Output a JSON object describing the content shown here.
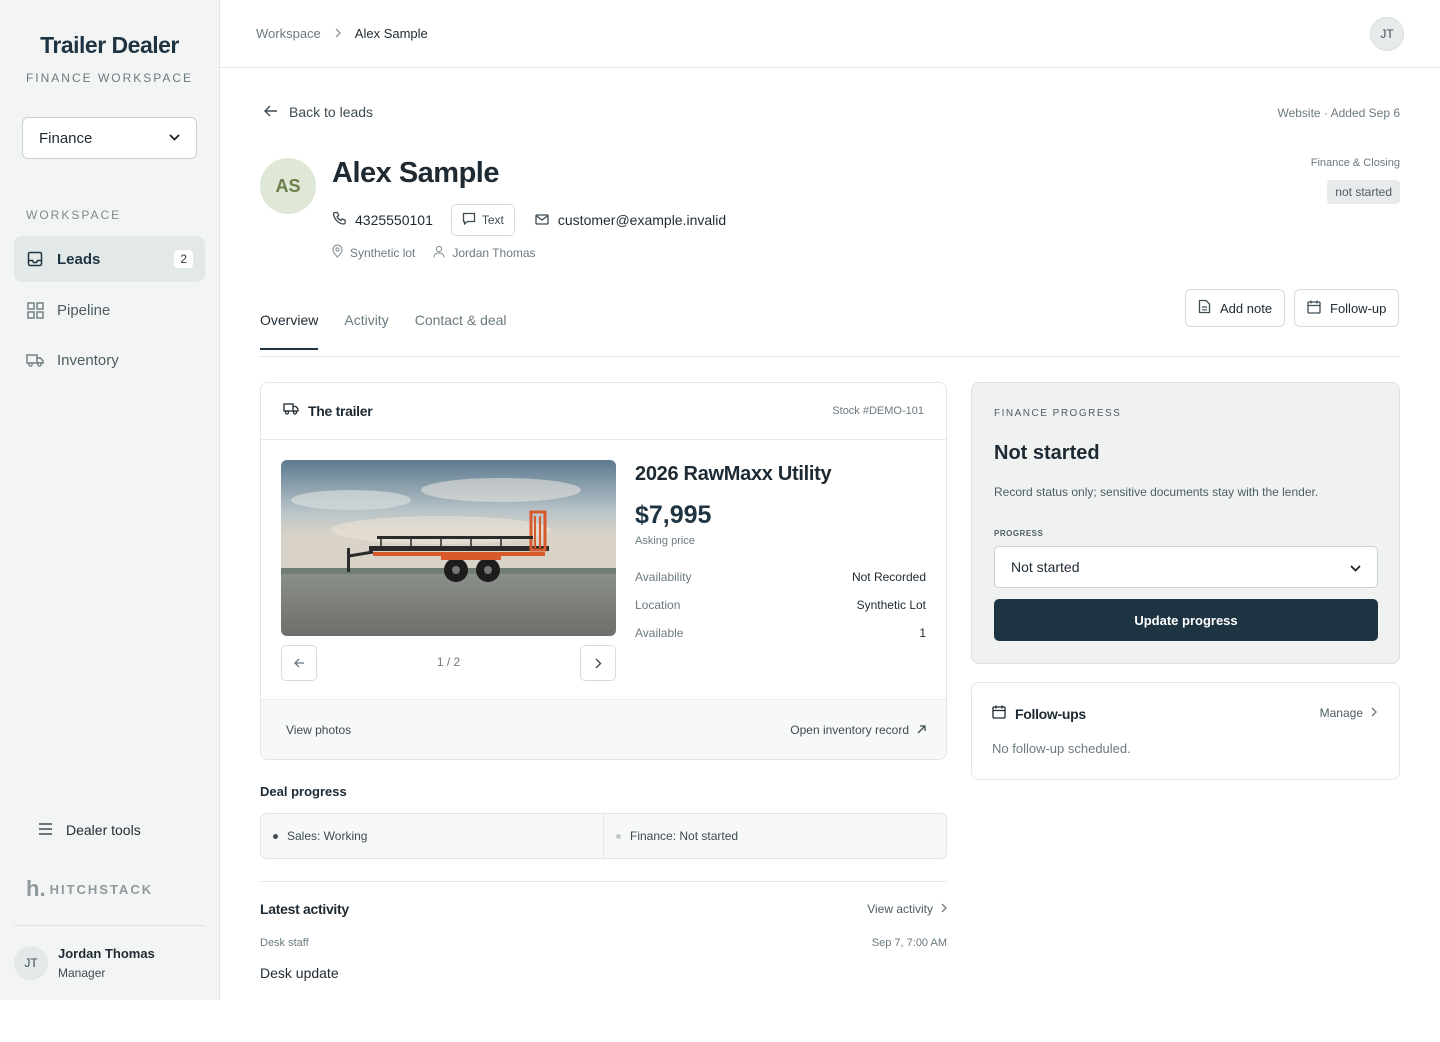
{
  "sidebar": {
    "brand": "Trailer Dealer",
    "brand_sub": "FINANCE WORKSPACE",
    "workspace_select": "Finance",
    "section_label": "WORKSPACE",
    "nav": [
      {
        "label": "Leads",
        "icon": "inbox-icon",
        "badge": "2",
        "active": true
      },
      {
        "label": "Pipeline",
        "icon": "grid-icon"
      },
      {
        "label": "Inventory",
        "icon": "truck-icon"
      }
    ],
    "tools_label": "Dealer tools",
    "vendor_mark": "h.",
    "vendor_name": "HITCHSTACK",
    "user": {
      "initials": "JT",
      "name": "Jordan Thomas",
      "role": "Manager"
    }
  },
  "topbar": {
    "breadcrumb": [
      "Workspace",
      "Alex Sample"
    ],
    "avatar_initials": "JT"
  },
  "lead": {
    "back_label": "Back to leads",
    "source_line": "Website · Added Sep 6",
    "initials": "AS",
    "name": "Alex Sample",
    "phone": "4325550101",
    "text_button": "Text",
    "email": "customer@example.invalid",
    "lot": "Synthetic lot",
    "owner": "Jordan Thomas",
    "stage_label": "Finance & Closing",
    "stage_status": "not started"
  },
  "actions": {
    "add_note": "Add note",
    "follow_up": "Follow-up"
  },
  "tabs": [
    {
      "label": "Overview",
      "active": true
    },
    {
      "label": "Activity"
    },
    {
      "label": "Contact & deal"
    }
  ],
  "trailer": {
    "title": "The trailer",
    "stock": "Stock #DEMO-101",
    "photo_counter": "1 / 2",
    "name": "2026 RawMaxx Utility",
    "price": "$7,995",
    "price_label": "Asking price",
    "specs": [
      {
        "key": "Availability",
        "value": "Not Recorded"
      },
      {
        "key": "Location",
        "value": "Synthetic Lot"
      },
      {
        "key": "Available",
        "value": "1"
      }
    ],
    "view_photos": "View photos",
    "open_record": "Open inventory record"
  },
  "deal_progress": {
    "title": "Deal progress",
    "items": [
      {
        "label": "Sales: Working",
        "color": "#3d4c53"
      },
      {
        "label": "Finance: Not started",
        "color": "#c3c9cb"
      }
    ]
  },
  "latest_activity": {
    "title": "Latest activity",
    "link": "View activity",
    "who": "Desk staff",
    "when": "Sep 7, 7:00 AM",
    "message": "Desk update"
  },
  "finance": {
    "label": "FINANCE PROGRESS",
    "status": "Not started",
    "note": "Record status only; sensitive documents stay with the lender.",
    "progress_label": "PROGRESS",
    "select_value": "Not started",
    "button": "Update progress"
  },
  "followups": {
    "title": "Follow-ups",
    "manage": "Manage",
    "empty": "No follow-up scheduled."
  }
}
